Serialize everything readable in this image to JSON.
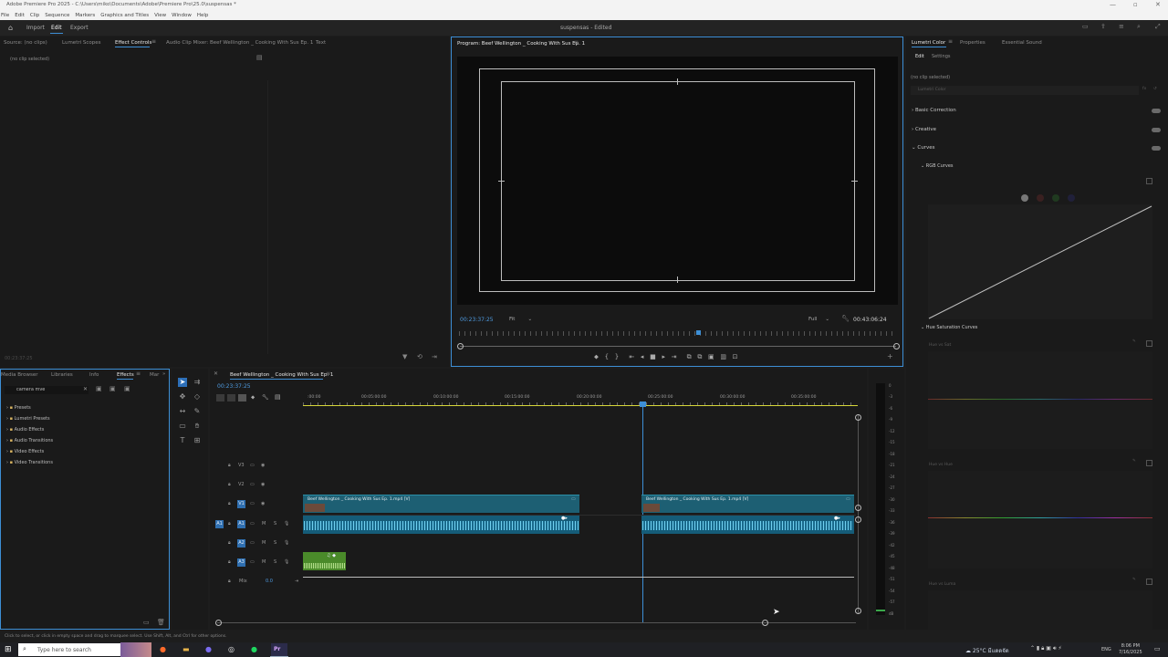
{
  "window": {
    "title": "Adobe Premiere Pro 2025 - C:\\Users\\miko\\Documents\\Adobe\\Premiere Pro\\25.0\\suspensas *"
  },
  "menu": [
    "File",
    "Edit",
    "Clip",
    "Sequence",
    "Markers",
    "Graphics and Titles",
    "View",
    "Window",
    "Help"
  ],
  "header": {
    "nav": [
      "Import",
      "Edit",
      "Export"
    ],
    "project_title": "suspensas - Edited"
  },
  "source_panel": {
    "tabs": [
      "Source: (no clips)",
      "Lumetri Scopes",
      "Effect Controls",
      "Audio Clip Mixer: Beef Wellington _ Cooking With Sus Ep. 1",
      "Text"
    ],
    "empty": "(no clip selected)",
    "timecode": "00:23:37:25"
  },
  "program": {
    "tab": "Program: Beef Wellington _ Cooking With Sus Ep. 1",
    "timecode": "00:23:37:25",
    "fit": "Fit",
    "quality": "Full",
    "duration": "00:43:06:24"
  },
  "lumetri": {
    "tabs": [
      "Lumetri Color",
      "Properties",
      "Essential Sound"
    ],
    "subtabs": [
      "Edit",
      "Settings"
    ],
    "clip": "(no clip selected)",
    "look": "Lumetri Color",
    "sections": [
      "Basic Correction",
      "Creative",
      "Curves"
    ],
    "rgb": "RGB Curves",
    "hue_sat": "Hue Saturation Curves",
    "curves": [
      "Hue vs Sat",
      "Hue vs Hue",
      "Hue vs Luma"
    ]
  },
  "effects_panel": {
    "tabs": [
      "Media Browser",
      "Libraries",
      "Info",
      "Effects",
      "Mar"
    ],
    "search": "camera mve",
    "items": [
      "Presets",
      "Lumetri Presets",
      "Audio Effects",
      "Audio Transitions",
      "Video Effects",
      "Video Transitions"
    ]
  },
  "timeline": {
    "tab": "Beef Wellington _ Cooking With Sus Ep. 1",
    "timecode": "00:23:37:25",
    "ruler": [
      ":00:00",
      "00:05:00:00",
      "00:10:00:00",
      "00:15:00:00",
      "00:20:00:00",
      "00:25:00:00",
      "00:30:00:00",
      "00:35:00:00"
    ],
    "tracks": [
      "V3",
      "V2",
      "V1",
      "A1",
      "A2",
      "A3"
    ],
    "source_a1": "A1",
    "mix_label": "Mix",
    "mix_value": "0.0",
    "clip1": "Beef Wellington _ Cooking With Sus Ep. 1.mp4 [V]",
    "clip2": "Beef Wellington _ Cooking With Sus Ep. 1.mp4 [V]",
    "meter": [
      "0",
      "-3",
      "-6",
      "-9",
      "-12",
      "-15",
      "-18",
      "-21",
      "-24",
      "-27",
      "-30",
      "-33",
      "-36",
      "-39",
      "-42",
      "-45",
      "-48",
      "-51",
      "-54",
      "-57",
      "dB"
    ]
  },
  "status": "Click to select, or click in empty space and drag to marquee select. Use Shift, Alt, and Ctrl for other options.",
  "taskbar": {
    "search": "Type here to search",
    "weather": "25°C  มีแดดจัด",
    "lang": "ENG",
    "time": "8:06 PM",
    "date": "7/16/2025"
  },
  "colors": {
    "accent": "#3d8fd6",
    "video_clip": "#1d5f73",
    "audio_clip": "#155c78",
    "green_clip": "#4a8a2a",
    "ruler_line": "#d6d63a"
  }
}
